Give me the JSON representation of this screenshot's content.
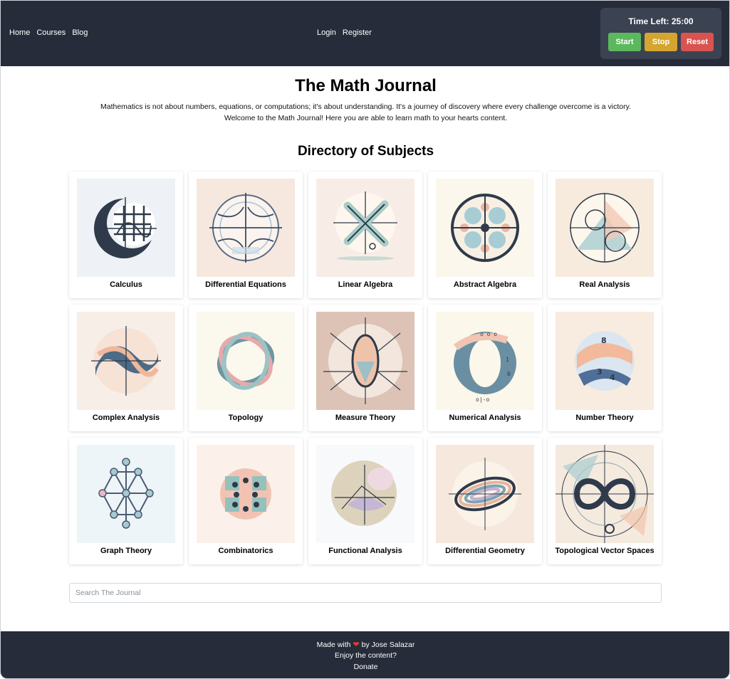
{
  "nav": {
    "left": [
      "Home",
      "Courses",
      "Blog"
    ],
    "center": [
      "Login",
      "Register"
    ]
  },
  "timer": {
    "label": "Time Left: 25:00",
    "start": "Start",
    "stop": "Stop",
    "reset": "Reset"
  },
  "page": {
    "title": "The Math Journal",
    "intro_line1": "Mathematics is not about numbers, equations, or computations; it's about understanding. It's a journey of discovery where every challenge overcome is a victory.",
    "intro_line2": "Welcome to the Math Journal! Here you are able to learn math to your hearts content.",
    "directory_title": "Directory of Subjects"
  },
  "subjects": [
    {
      "label": "Calculus",
      "icon": "calculus-icon"
    },
    {
      "label": "Differential Equations",
      "icon": "differential-equations-icon"
    },
    {
      "label": "Linear Algebra",
      "icon": "linear-algebra-icon"
    },
    {
      "label": "Abstract Algebra",
      "icon": "abstract-algebra-icon"
    },
    {
      "label": "Real Analysis",
      "icon": "real-analysis-icon"
    },
    {
      "label": "Complex Analysis",
      "icon": "complex-analysis-icon"
    },
    {
      "label": "Topology",
      "icon": "topology-icon"
    },
    {
      "label": "Measure Theory",
      "icon": "measure-theory-icon"
    },
    {
      "label": "Numerical Analysis",
      "icon": "numerical-analysis-icon"
    },
    {
      "label": "Number Theory",
      "icon": "number-theory-icon"
    },
    {
      "label": "Graph Theory",
      "icon": "graph-theory-icon"
    },
    {
      "label": "Combinatorics",
      "icon": "combinatorics-icon"
    },
    {
      "label": "Functional Analysis",
      "icon": "functional-analysis-icon"
    },
    {
      "label": "Differential Geometry",
      "icon": "differential-geometry-icon"
    },
    {
      "label": "Topological Vector Spaces",
      "icon": "topological-vector-spaces-icon"
    }
  ],
  "search": {
    "placeholder": "Search The Journal"
  },
  "footer": {
    "made_with": "Made with",
    "by": "by Jose Salazar",
    "enjoy": "Enjoy the content?",
    "donate": "Donate"
  },
  "colors": {
    "header_bg": "#262c3a",
    "timer_bg": "#3b4252",
    "start": "#5cb85c",
    "stop": "#d4a52f",
    "reset": "#d9534f",
    "heart": "#e53935"
  }
}
